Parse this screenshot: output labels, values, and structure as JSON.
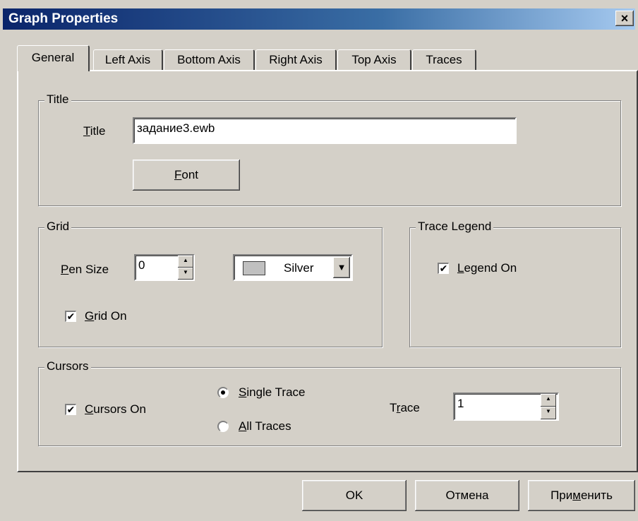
{
  "window": {
    "title": "Graph Properties",
    "close_glyph": "×"
  },
  "tabs": [
    {
      "label": "General",
      "active": true
    },
    {
      "label": "Left Axis"
    },
    {
      "label": "Bottom Axis"
    },
    {
      "label": "Right Axis"
    },
    {
      "label": "Top Axis"
    },
    {
      "label": "Traces"
    }
  ],
  "title_group": {
    "legend": "Title",
    "title_label_accel": "T",
    "title_label_rest": "itle",
    "title_value": "задание3.ewb",
    "font_btn_accel": "F",
    "font_btn_rest": "ont"
  },
  "grid_group": {
    "legend": "Grid",
    "pen_size_label_accel": "P",
    "pen_size_label_rest": "en Size",
    "pen_size_value": "0",
    "color_value": "Silver",
    "color_hex": "#c0c0c0",
    "grid_on_accel": "G",
    "grid_on_rest": "rid On",
    "grid_on_checked": true
  },
  "legend_group": {
    "legend": "Trace Legend",
    "legend_on_accel": "L",
    "legend_on_rest": "egend On",
    "legend_on_checked": true
  },
  "cursors_group": {
    "legend": "Cursors",
    "cursors_on_accel": "C",
    "cursors_on_rest": "ursors On",
    "cursors_on_checked": true,
    "single_trace_accel": "S",
    "single_trace_rest": "ingle Trace",
    "all_traces_accel": "A",
    "all_traces_rest": "ll Traces",
    "selected_mode": "single",
    "trace_label_pre": "T",
    "trace_label_accel": "r",
    "trace_label_rest": "ace",
    "trace_value": "1"
  },
  "buttons": {
    "ok": "OK",
    "cancel": "Отмена",
    "apply_pre": "При",
    "apply_accel": "м",
    "apply_rest": "енить"
  },
  "glyphs": {
    "check": "✔",
    "up": "▲",
    "down": "▼",
    "dropdown": "▼"
  }
}
